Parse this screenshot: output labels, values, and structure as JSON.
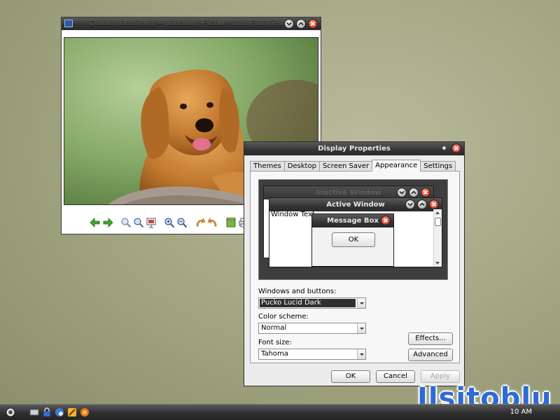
{
  "viewer": {
    "title": "Golden Retriever - Windows Picture and Fax Viewer",
    "photo_alt": "Golden Retriever"
  },
  "display_properties": {
    "title": "Display Properties",
    "tabs": [
      {
        "label": "Themes",
        "active": false
      },
      {
        "label": "Desktop",
        "active": false
      },
      {
        "label": "Screen Saver",
        "active": false
      },
      {
        "label": "Appearance",
        "active": true
      },
      {
        "label": "Settings",
        "active": false
      }
    ],
    "preview": {
      "inactive_title": "Inactive Window",
      "active_title": "Active Window",
      "window_text": "Window Text",
      "message_box_title": "Message Box",
      "ok_label": "OK"
    },
    "windows_buttons": {
      "label": "Windows and buttons:",
      "value": "Pucko Lucid Dark"
    },
    "color_scheme": {
      "label": "Color scheme:",
      "value": "Normal"
    },
    "font_size": {
      "label": "Font size:",
      "value": "Tahoma"
    },
    "effects_label": "Effects...",
    "advanced_label": "Advanced",
    "ok_label": "OK",
    "cancel_label": "Cancel",
    "apply_label": "Apply"
  },
  "taskbar": {
    "clock": "10 AM",
    "icons": [
      "start-orb-icon",
      "show-desktop-icon",
      "lock-icon",
      "network-icon",
      "media-icon",
      "firefox-icon"
    ]
  },
  "watermark": "Ilsitoblu",
  "colors": {
    "titlebar": "#343434",
    "close_button": "#d9402c",
    "accent_blue": "#2f6bd6",
    "desktop": "#a4a884"
  }
}
